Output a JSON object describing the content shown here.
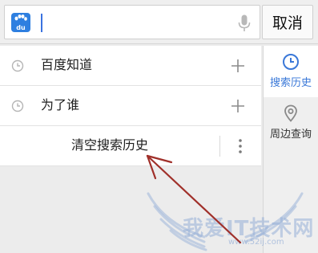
{
  "search": {
    "logo_text": "du",
    "value": "",
    "cancel_label": "取消"
  },
  "history": {
    "items": [
      {
        "label": "百度知道",
        "icon": "clock-icon",
        "action_icon": "plus-icon"
      },
      {
        "label": "为了谁",
        "icon": "clock-icon",
        "action_icon": "plus-icon"
      }
    ],
    "clear_label": "清空搜索历史",
    "more_icon": "vertical-dots-icon"
  },
  "side_tabs": [
    {
      "label": "搜索历史",
      "icon": "clock-icon",
      "active": true
    },
    {
      "label": "周边查询",
      "icon": "location-pin-icon",
      "active": false
    }
  ],
  "watermark": {
    "text": "我爱IT技术网",
    "url": "www.52ij.com"
  },
  "colors": {
    "accent": "#3a78d8",
    "logo": "#2e7fe0",
    "arrow": "#a0302a"
  }
}
